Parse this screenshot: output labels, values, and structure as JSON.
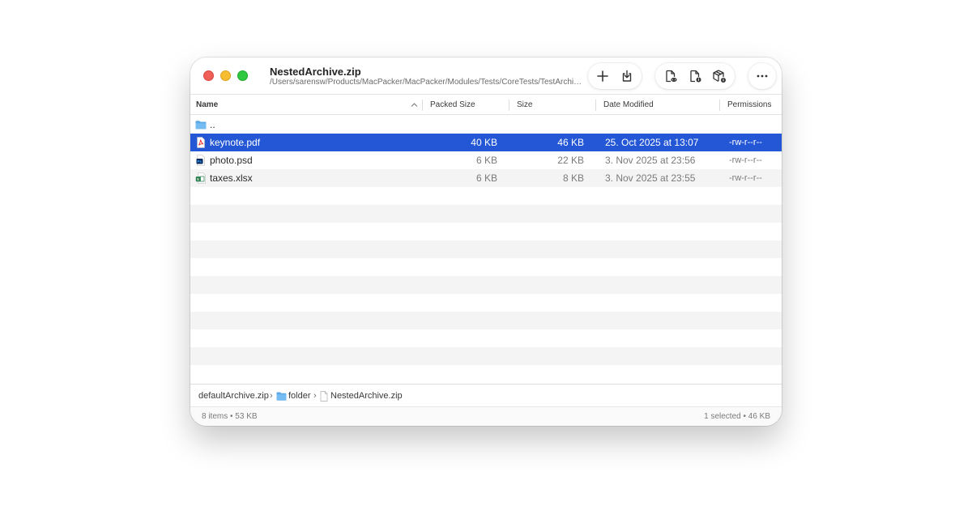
{
  "window": {
    "title": "NestedArchive.zip",
    "subtitle": "/Users/sarensw/Products/MacPacker/MacPacker/Modules/Tests/CoreTests/TestArchives/NestedArchive.zip"
  },
  "toolbar": {
    "buttons": [
      {
        "icon": "plus-icon"
      },
      {
        "icon": "extract-icon"
      },
      {
        "icon": "file-preview-icon"
      },
      {
        "icon": "file-info-icon"
      },
      {
        "icon": "archive-info-icon"
      },
      {
        "icon": "more-icon"
      }
    ]
  },
  "columns": {
    "name": "Name",
    "packed": "Packed Size",
    "size": "Size",
    "date": "Date Modified",
    "permissions": "Permissions"
  },
  "rows": [
    {
      "icon": "folder-icon",
      "name": "..",
      "packed": "",
      "size": "",
      "date": "",
      "permissions": "",
      "selected": false
    },
    {
      "icon": "pdf-icon",
      "name": "keynote.pdf",
      "packed": "40 KB",
      "size": "46 KB",
      "date": "25. Oct 2025 at 13:07",
      "permissions": "-rw-r--r--",
      "selected": true
    },
    {
      "icon": "psd-icon",
      "name": "photo.psd",
      "packed": "6 KB",
      "size": "22 KB",
      "date": "3. Nov 2025 at 23:56",
      "permissions": "-rw-r--r--",
      "selected": false
    },
    {
      "icon": "xlsx-icon",
      "name": "taxes.xlsx",
      "packed": "6 KB",
      "size": "8 KB",
      "date": "3. Nov 2025 at 23:55",
      "permissions": "-rw-r--r--",
      "selected": false
    }
  ],
  "breadcrumb": [
    {
      "label": "defaultArchive.zip",
      "icon": ""
    },
    {
      "label": "folder",
      "icon": "folder-icon"
    },
    {
      "label": "NestedArchive.zip",
      "icon": "file-icon"
    }
  ],
  "status": {
    "left": "8 items • 53 KB",
    "right": "1 selected • 46 KB"
  },
  "colors": {
    "selection": "#2457d6",
    "close": "#ee5f57",
    "minimize": "#f5bd2f",
    "maximize": "#2fc840"
  }
}
